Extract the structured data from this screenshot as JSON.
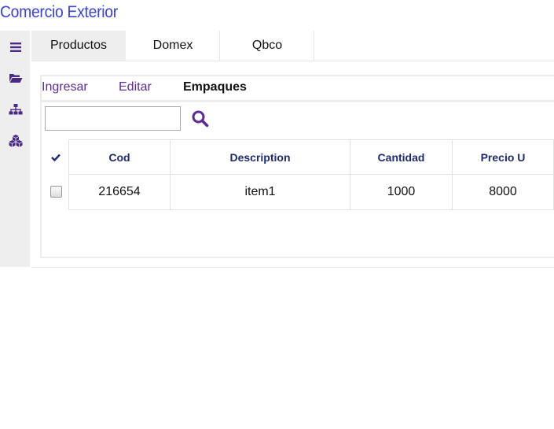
{
  "app": {
    "title": "Comercio Exterior"
  },
  "sidebar": {
    "icons": [
      "menu-icon",
      "folder-open-icon",
      "sitemap-icon",
      "cubes-icon"
    ]
  },
  "tabs": [
    {
      "label": "Productos",
      "active": true
    },
    {
      "label": "Domex",
      "active": false
    },
    {
      "label": "Qbco",
      "active": false
    }
  ],
  "subtabs": [
    {
      "label": "Ingresar",
      "active": false
    },
    {
      "label": "Editar",
      "active": false
    },
    {
      "label": "Empaques",
      "active": true
    }
  ],
  "search": {
    "value": "",
    "placeholder": ""
  },
  "table": {
    "headers": [
      "Cod",
      "Description",
      "Cantidad",
      "Precio U"
    ],
    "rows": [
      {
        "cod": "216654",
        "description": "item1",
        "cantidad": "1000",
        "precio": "8000"
      }
    ]
  },
  "colors": {
    "title": "#3b45c8",
    "accent": "#5b2d8e",
    "header_text": "#1f2a6d"
  }
}
